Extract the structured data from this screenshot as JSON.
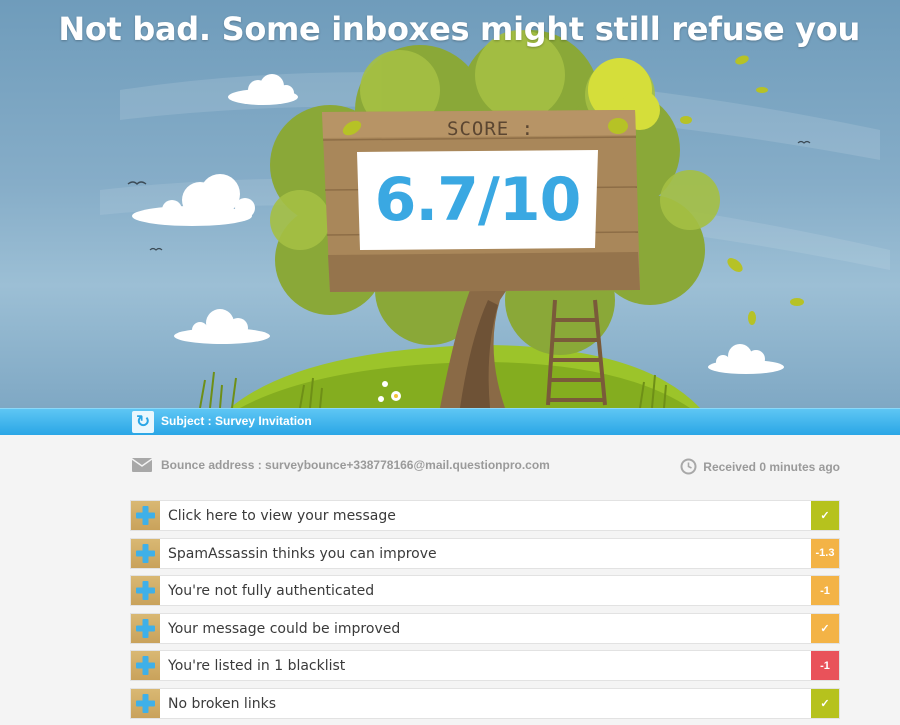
{
  "hero": {
    "headline": "Not bad. Some inboxes might still refuse you",
    "score_label": "SCORE :",
    "score_value": "6.7/10"
  },
  "subject": {
    "text": "Subject : Survey Invitation"
  },
  "info": {
    "bounce": "Bounce address : surveybounce+338778166@mail.questionpro.com",
    "received": "Received 0 minutes ago"
  },
  "colors": {
    "accent_blue": "#2aa6e6",
    "good": "#b6c21d",
    "warn": "#f3b346",
    "bad": "#e9525a"
  },
  "checks": [
    {
      "label": "Click here to view your message",
      "badge": "✓",
      "status": "good",
      "icon": "plus-icon"
    },
    {
      "label": "SpamAssassin thinks you can improve",
      "badge": "-1.3",
      "status": "warn",
      "icon": "plus-icon"
    },
    {
      "label": "You're not fully authenticated",
      "badge": "-1",
      "status": "warn",
      "icon": "plus-icon"
    },
    {
      "label": "Your message could be improved",
      "badge": "✓",
      "status": "warn",
      "icon": "plus-icon"
    },
    {
      "label": "You're listed in 1 blacklist",
      "badge": "-1",
      "status": "bad",
      "icon": "plus-icon"
    },
    {
      "label": "No broken links",
      "badge": "✓",
      "status": "good",
      "icon": "plus-icon"
    }
  ]
}
